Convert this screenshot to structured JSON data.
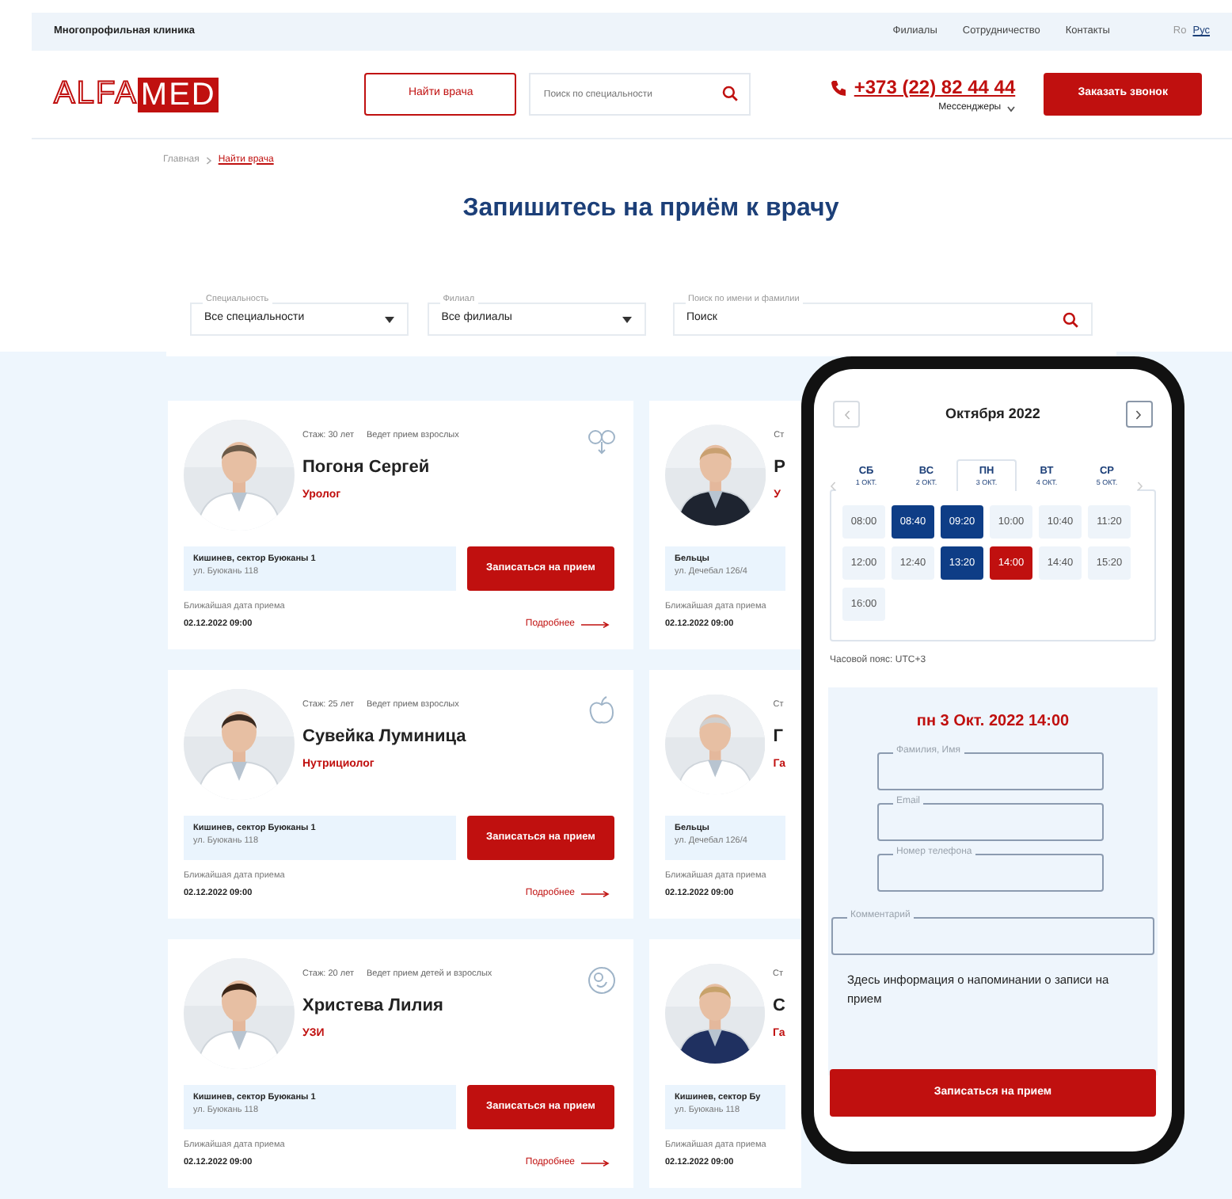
{
  "topbar": {
    "title": "Многопрофильная клиника",
    "links": [
      "Филиалы",
      "Сотрудничество",
      "Контакты"
    ],
    "languages": [
      {
        "label": "Ro",
        "selected": false
      },
      {
        "label": "Рус",
        "selected": true
      }
    ]
  },
  "header": {
    "logo": [
      "ALFA",
      "MED"
    ],
    "find_button": "Найти врача",
    "search": {
      "placeholder": "Поиск по специальности"
    },
    "phone": "+373 (22) 82 44 44",
    "messengers": "Мессенджеры",
    "call_button": "Заказать звонок"
  },
  "breadcrumb": [
    "Главная",
    "Найти врача"
  ],
  "heading": "Запишитесь на приём к врачу",
  "filters": [
    {
      "label": "Специальность",
      "value": "Все специальности",
      "kind": "select"
    },
    {
      "label": "Филиал",
      "value": "Все филиалы",
      "kind": "select"
    },
    {
      "label": "Поиск по имени и фамилии",
      "value": "Поиск",
      "kind": "search"
    }
  ],
  "doctors": [
    {
      "experience": "Стаж: 30 лет",
      "patients": "Ведет прием взрослых",
      "name": "Погоня Сергей",
      "specialty": "Уролог",
      "branch": "Кишинев, сектор Буюканы 1",
      "street": "ул. Буюкань 118",
      "button": "Записаться на прием",
      "next_label": "Ближайшая дата приема",
      "next_date": "02.12.2022 09:00",
      "more": "Подробнее"
    },
    {
      "experience": "Ст",
      "name": "Р",
      "specialty": "У",
      "branch": "Бельцы",
      "street": "ул. Дечебал 126/4",
      "next_label": "Ближайшая дата приема",
      "next_date": "02.12.2022 09:00"
    },
    {
      "experience": "Стаж: 25 лет",
      "patients": "Ведет прием взрослых",
      "name": "Сувейка Луминица",
      "specialty": "Нутрициолог",
      "branch": "Кишинев, сектор Буюканы 1",
      "street": "ул. Буюкань 118",
      "button": "Записаться на прием",
      "next_label": "Ближайшая дата приема",
      "next_date": "02.12.2022 09:00",
      "more": "Подробнее"
    },
    {
      "experience": "Ст",
      "name": "Г",
      "specialty": "Га",
      "branch": "Бельцы",
      "street": "ул. Дечебал 126/4",
      "next_label": "Ближайшая дата приема",
      "next_date": "02.12.2022 09:00"
    },
    {
      "experience": "Стаж: 20 лет",
      "patients": "Ведет прием детей и взрослых",
      "name": "Христева Лилия",
      "specialty": "УЗИ",
      "branch": "Кишинев, сектор Буюканы 1",
      "street": "ул. Буюкань 118",
      "button": "Записаться на прием",
      "next_label": "Ближайшая дата приема",
      "next_date": "02.12.2022 09:00",
      "more": "Подробнее"
    },
    {
      "experience": "Ст",
      "name": "С",
      "specialty": "Га",
      "branch": "Кишинев, сектор Бу",
      "street": "ул. Буюкань 118",
      "next_label": "Ближайшая дата приема",
      "next_date": "02.12.2022 09:00"
    }
  ],
  "booking": {
    "month": "Октября 2022",
    "days": [
      {
        "weekday": "СБ",
        "date": "1 ОКТ.",
        "selected": false
      },
      {
        "weekday": "ВС",
        "date": "2 ОКТ.",
        "selected": false
      },
      {
        "weekday": "ПН",
        "date": "3 ОКТ.",
        "selected": true
      },
      {
        "weekday": "ВТ",
        "date": "4 ОКТ.",
        "selected": false
      },
      {
        "weekday": "СР",
        "date": "5 ОКТ.",
        "selected": false
      }
    ],
    "slots": [
      {
        "time": "08:00",
        "booked": false,
        "selected": false
      },
      {
        "time": "08:40",
        "booked": true,
        "selected": false
      },
      {
        "time": "09:20",
        "booked": true,
        "selected": false
      },
      {
        "time": "10:00",
        "booked": false,
        "selected": false
      },
      {
        "time": "10:40",
        "booked": false,
        "selected": false
      },
      {
        "time": "11:20",
        "booked": false,
        "selected": false
      },
      {
        "time": "12:00",
        "booked": false,
        "selected": false
      },
      {
        "time": "12:40",
        "booked": false,
        "selected": false
      },
      {
        "time": "13:20",
        "booked": true,
        "selected": false
      },
      {
        "time": "14:00",
        "booked": false,
        "selected": true
      },
      {
        "time": "14:40",
        "booked": false,
        "selected": false
      },
      {
        "time": "15:20",
        "booked": false,
        "selected": false
      },
      {
        "time": "16:00",
        "booked": false,
        "selected": false
      }
    ],
    "timezone": "Часовой пояс: UTC+3",
    "chosen": "пн 3 Окт. 2022 14:00",
    "fields": [
      {
        "label": "Фамилия, Имя",
        "kind": "short"
      },
      {
        "label": "Email",
        "kind": "short"
      },
      {
        "label": "Номер телефона",
        "kind": "short"
      },
      {
        "label": "Комментарий",
        "kind": "wide"
      }
    ],
    "note": "Здесь информация о напоминании о записи на прием",
    "submit": "Записаться на прием"
  }
}
